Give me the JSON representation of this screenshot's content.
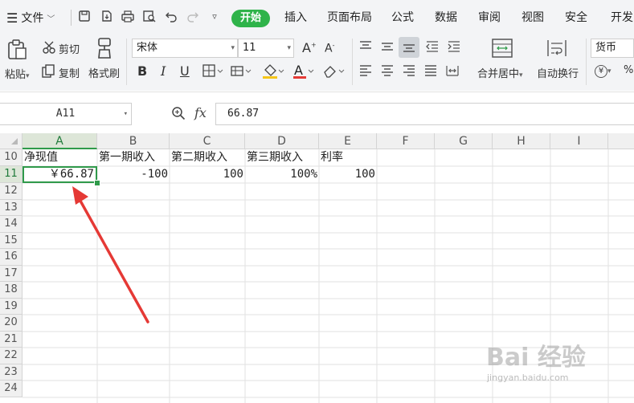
{
  "menubar": {
    "file_label": "文件",
    "tabs": [
      "开始",
      "插入",
      "页面布局",
      "公式",
      "数据",
      "审阅",
      "视图",
      "安全",
      "开发"
    ],
    "active_tab": "开始"
  },
  "ribbon": {
    "paste": "粘贴",
    "cut": "剪切",
    "copy": "复制",
    "format_painter": "格式刷",
    "font_name": "宋体",
    "font_size": "11",
    "bold": "B",
    "italic": "I",
    "underline": "U",
    "font_color_letter": "A",
    "grow_font": "A",
    "shrink_font": "A",
    "merge_center": "合并居中",
    "wrap_text": "自动换行",
    "number_format": "货币",
    "currency_symbol": "¥",
    "percent": "%"
  },
  "formula_bar": {
    "name_box": "A11",
    "fx_label": "fx",
    "formula": "66.87"
  },
  "columns": [
    "A",
    "B",
    "C",
    "D",
    "E",
    "F",
    "G",
    "H",
    "I"
  ],
  "rows": [
    "10",
    "11",
    "12",
    "13",
    "14",
    "15",
    "16",
    "17",
    "18",
    "19",
    "20",
    "21",
    "22",
    "23",
    "24"
  ],
  "cells": {
    "A10": "净现值",
    "B10": "第一期收入",
    "C10": "第二期收入",
    "D10": "第三期收入",
    "E10": "利率",
    "A11": "￥66.87",
    "B11": "-100",
    "C11": "100",
    "D11": "100%",
    "E11": "100"
  },
  "selected_cell": "A11",
  "accent_colors": {
    "active_tab": "#2fb34a",
    "selection": "#2f9a4a",
    "annotation_arrow": "#e53935"
  },
  "watermark": {
    "brand": "Bai 经验",
    "url": "jingyan.baidu.com"
  }
}
